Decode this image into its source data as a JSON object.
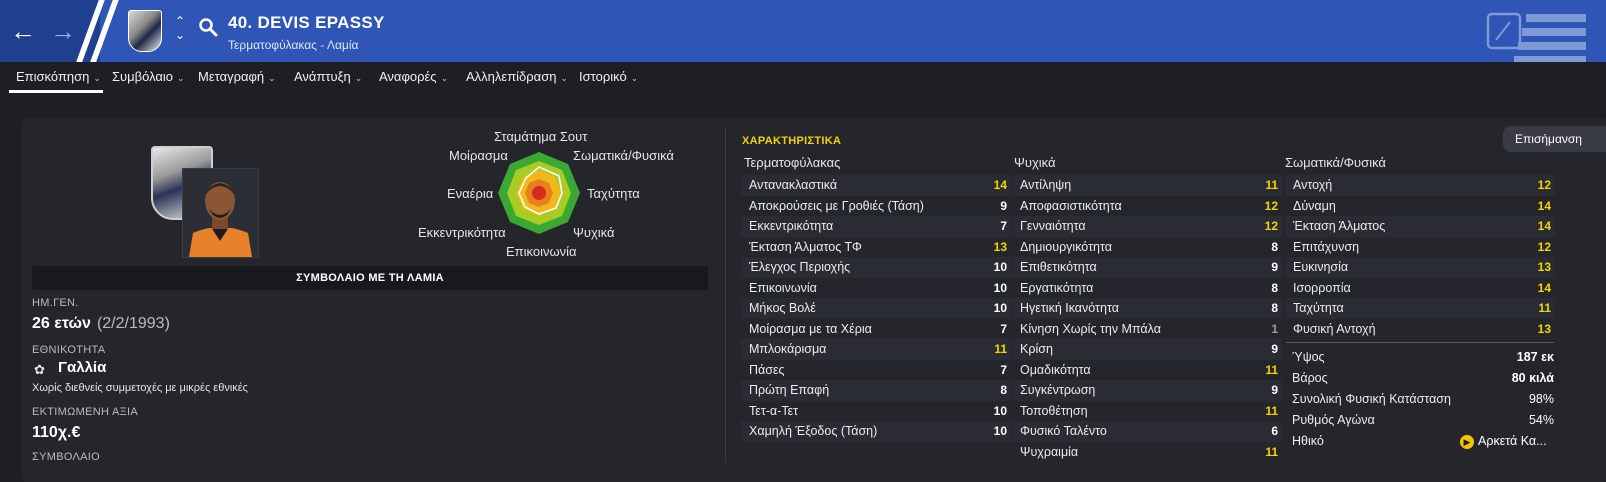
{
  "header": {
    "player_name": "40. DEVIS EPASSY",
    "subtitle": "Τερματοφύλακας - Λαμία",
    "back_icon": "arrow-left-icon",
    "forward_icon": "arrow-right-icon",
    "search_icon": "search-icon",
    "colors": {
      "bar": "#2f55b6",
      "accent": "#ffffff"
    }
  },
  "tabs": [
    {
      "label": "Επισκόπηση",
      "active": true
    },
    {
      "label": "Συμβόλαιο"
    },
    {
      "label": "Μεταγραφή"
    },
    {
      "label": "Ανάπτυξη"
    },
    {
      "label": "Αναφορές"
    },
    {
      "label": "Αλληλεπίδραση"
    },
    {
      "label": "Ιστορικό"
    }
  ],
  "radar": {
    "labels": [
      "Σταμάτημα Σουτ",
      "Σωματικά/Φυσικά",
      "Ταχύτητα",
      "Ψυχικά",
      "Επικοινωνία",
      "Εκκεντρικότητα",
      "Εναέρια",
      "Μοίρασμα"
    ]
  },
  "overview": {
    "contract_bar": "ΣΥΜΒΟΛΑΙΟ ΜΕ ΤΗ ΛΑΜΙΑ",
    "dob_label": "ΗΜ.ΓΕΝ.",
    "age": "26 ετών",
    "dob": "(2/2/1993)",
    "nationality_label": "ΕΘΝΙΚΟΤΗΤΑ",
    "nationality": "Γαλλία",
    "nationality_note": "Χωρίς διεθνείς συμμετοχές με μικρές εθνικές",
    "value_label": "ΕΚΤΙΜΩΜΕΝΗ ΑΞΙΑ",
    "value": "110χ.€",
    "contract_label": "ΣΥΜΒΟΛΑΙΟ"
  },
  "attributes": {
    "title": "ΧΑΡΑΚΤΗΡΙΣΤΙΚΑ",
    "notes_tab": "Επισήμανση",
    "goalkeeping": {
      "heading": "Τερματοφύλακας",
      "items": [
        {
          "name": "Αντανακλαστικά",
          "value": "14"
        },
        {
          "name": "Αποκρούσεις με Γροθιές (Τάση)",
          "value": "9"
        },
        {
          "name": "Εκκεντρικότητα",
          "value": "7"
        },
        {
          "name": "Έκταση Άλματος ΤΦ",
          "value": "13"
        },
        {
          "name": "Έλεγχος Περιοχής",
          "value": "10"
        },
        {
          "name": "Επικοινωνία",
          "value": "10"
        },
        {
          "name": "Μήκος Βολέ",
          "value": "10"
        },
        {
          "name": "Μοίρασμα με τα Χέρια",
          "value": "7"
        },
        {
          "name": "Μπλοκάρισμα",
          "value": "11"
        },
        {
          "name": "Πάσες",
          "value": "7"
        },
        {
          "name": "Πρώτη Επαφή",
          "value": "8"
        },
        {
          "name": "Τετ-α-Τετ",
          "value": "10"
        },
        {
          "name": "Χαμηλή Έξοδος (Τάση)",
          "value": "10"
        }
      ]
    },
    "mental": {
      "heading": "Ψυχικά",
      "items": [
        {
          "name": "Αντίληψη",
          "value": "11"
        },
        {
          "name": "Αποφασιστικότητα",
          "value": "12"
        },
        {
          "name": "Γενναιότητα",
          "value": "12"
        },
        {
          "name": "Δημιουργικότητα",
          "value": "8"
        },
        {
          "name": "Επιθετικότητα",
          "value": "9"
        },
        {
          "name": "Εργατικότητα",
          "value": "8"
        },
        {
          "name": "Ηγετική Ικανότητα",
          "value": "8"
        },
        {
          "name": "Κίνηση Χωρίς την Μπάλα",
          "value": "1"
        },
        {
          "name": "Κρίση",
          "value": "9"
        },
        {
          "name": "Ομαδικότητα",
          "value": "11"
        },
        {
          "name": "Συγκέντρωση",
          "value": "9"
        },
        {
          "name": "Τοποθέτηση",
          "value": "11"
        },
        {
          "name": "Φυσικό Ταλέντο",
          "value": "6"
        },
        {
          "name": "Ψυχραιμία",
          "value": "11"
        }
      ]
    },
    "physical": {
      "heading": "Σωματικά/Φυσικά",
      "items": [
        {
          "name": "Αντοχή",
          "value": "12"
        },
        {
          "name": "Δύναμη",
          "value": "14"
        },
        {
          "name": "Έκταση Άλματος",
          "value": "14"
        },
        {
          "name": "Επιτάχυνση",
          "value": "12"
        },
        {
          "name": "Ευκινησία",
          "value": "13"
        },
        {
          "name": "Ισορροπία",
          "value": "14"
        },
        {
          "name": "Ταχύτητα",
          "value": "11"
        },
        {
          "name": "Φυσική Αντοχή",
          "value": "13"
        }
      ]
    },
    "info": [
      {
        "name": "Ύψος",
        "value": "187 εκ"
      },
      {
        "name": "Βάρος",
        "value": "80 κιλά"
      },
      {
        "name": "Συνολική Φυσική Κατάσταση",
        "value": "98%"
      },
      {
        "name": "Ρυθμός Αγώνα",
        "value": "54%"
      },
      {
        "name": "Ηθικό",
        "value": "Αρκετά Κα..."
      }
    ],
    "status_colors": {
      "good": "#43c96a",
      "bad": "#e35b5b",
      "highlight": "#f5d400"
    }
  }
}
